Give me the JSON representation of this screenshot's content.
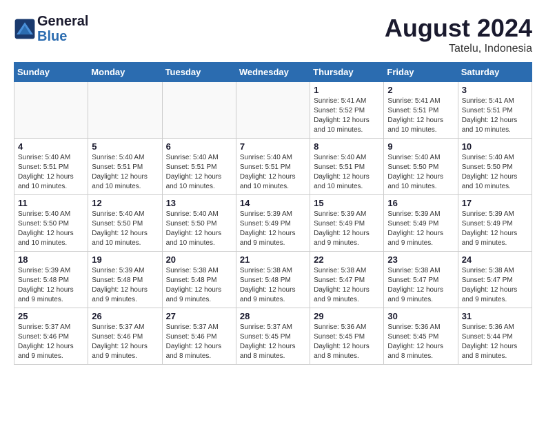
{
  "header": {
    "logo_general": "General",
    "logo_blue": "Blue",
    "month_title": "August 2024",
    "location": "Tatelu, Indonesia"
  },
  "calendar": {
    "weekdays": [
      "Sunday",
      "Monday",
      "Tuesday",
      "Wednesday",
      "Thursday",
      "Friday",
      "Saturday"
    ],
    "weeks": [
      [
        {
          "day": "",
          "info": "",
          "empty": true
        },
        {
          "day": "",
          "info": "",
          "empty": true
        },
        {
          "day": "",
          "info": "",
          "empty": true
        },
        {
          "day": "",
          "info": "",
          "empty": true
        },
        {
          "day": "1",
          "info": "Sunrise: 5:41 AM\nSunset: 5:52 PM\nDaylight: 12 hours\nand 10 minutes."
        },
        {
          "day": "2",
          "info": "Sunrise: 5:41 AM\nSunset: 5:51 PM\nDaylight: 12 hours\nand 10 minutes."
        },
        {
          "day": "3",
          "info": "Sunrise: 5:41 AM\nSunset: 5:51 PM\nDaylight: 12 hours\nand 10 minutes."
        }
      ],
      [
        {
          "day": "4",
          "info": "Sunrise: 5:40 AM\nSunset: 5:51 PM\nDaylight: 12 hours\nand 10 minutes."
        },
        {
          "day": "5",
          "info": "Sunrise: 5:40 AM\nSunset: 5:51 PM\nDaylight: 12 hours\nand 10 minutes."
        },
        {
          "day": "6",
          "info": "Sunrise: 5:40 AM\nSunset: 5:51 PM\nDaylight: 12 hours\nand 10 minutes."
        },
        {
          "day": "7",
          "info": "Sunrise: 5:40 AM\nSunset: 5:51 PM\nDaylight: 12 hours\nand 10 minutes."
        },
        {
          "day": "8",
          "info": "Sunrise: 5:40 AM\nSunset: 5:51 PM\nDaylight: 12 hours\nand 10 minutes."
        },
        {
          "day": "9",
          "info": "Sunrise: 5:40 AM\nSunset: 5:50 PM\nDaylight: 12 hours\nand 10 minutes."
        },
        {
          "day": "10",
          "info": "Sunrise: 5:40 AM\nSunset: 5:50 PM\nDaylight: 12 hours\nand 10 minutes."
        }
      ],
      [
        {
          "day": "11",
          "info": "Sunrise: 5:40 AM\nSunset: 5:50 PM\nDaylight: 12 hours\nand 10 minutes."
        },
        {
          "day": "12",
          "info": "Sunrise: 5:40 AM\nSunset: 5:50 PM\nDaylight: 12 hours\nand 10 minutes."
        },
        {
          "day": "13",
          "info": "Sunrise: 5:40 AM\nSunset: 5:50 PM\nDaylight: 12 hours\nand 10 minutes."
        },
        {
          "day": "14",
          "info": "Sunrise: 5:39 AM\nSunset: 5:49 PM\nDaylight: 12 hours\nand 9 minutes."
        },
        {
          "day": "15",
          "info": "Sunrise: 5:39 AM\nSunset: 5:49 PM\nDaylight: 12 hours\nand 9 minutes."
        },
        {
          "day": "16",
          "info": "Sunrise: 5:39 AM\nSunset: 5:49 PM\nDaylight: 12 hours\nand 9 minutes."
        },
        {
          "day": "17",
          "info": "Sunrise: 5:39 AM\nSunset: 5:49 PM\nDaylight: 12 hours\nand 9 minutes."
        }
      ],
      [
        {
          "day": "18",
          "info": "Sunrise: 5:39 AM\nSunset: 5:48 PM\nDaylight: 12 hours\nand 9 minutes."
        },
        {
          "day": "19",
          "info": "Sunrise: 5:39 AM\nSunset: 5:48 PM\nDaylight: 12 hours\nand 9 minutes."
        },
        {
          "day": "20",
          "info": "Sunrise: 5:38 AM\nSunset: 5:48 PM\nDaylight: 12 hours\nand 9 minutes."
        },
        {
          "day": "21",
          "info": "Sunrise: 5:38 AM\nSunset: 5:48 PM\nDaylight: 12 hours\nand 9 minutes."
        },
        {
          "day": "22",
          "info": "Sunrise: 5:38 AM\nSunset: 5:47 PM\nDaylight: 12 hours\nand 9 minutes."
        },
        {
          "day": "23",
          "info": "Sunrise: 5:38 AM\nSunset: 5:47 PM\nDaylight: 12 hours\nand 9 minutes."
        },
        {
          "day": "24",
          "info": "Sunrise: 5:38 AM\nSunset: 5:47 PM\nDaylight: 12 hours\nand 9 minutes."
        }
      ],
      [
        {
          "day": "25",
          "info": "Sunrise: 5:37 AM\nSunset: 5:46 PM\nDaylight: 12 hours\nand 9 minutes."
        },
        {
          "day": "26",
          "info": "Sunrise: 5:37 AM\nSunset: 5:46 PM\nDaylight: 12 hours\nand 9 minutes."
        },
        {
          "day": "27",
          "info": "Sunrise: 5:37 AM\nSunset: 5:46 PM\nDaylight: 12 hours\nand 8 minutes."
        },
        {
          "day": "28",
          "info": "Sunrise: 5:37 AM\nSunset: 5:45 PM\nDaylight: 12 hours\nand 8 minutes."
        },
        {
          "day": "29",
          "info": "Sunrise: 5:36 AM\nSunset: 5:45 PM\nDaylight: 12 hours\nand 8 minutes."
        },
        {
          "day": "30",
          "info": "Sunrise: 5:36 AM\nSunset: 5:45 PM\nDaylight: 12 hours\nand 8 minutes."
        },
        {
          "day": "31",
          "info": "Sunrise: 5:36 AM\nSunset: 5:44 PM\nDaylight: 12 hours\nand 8 minutes."
        }
      ]
    ]
  }
}
